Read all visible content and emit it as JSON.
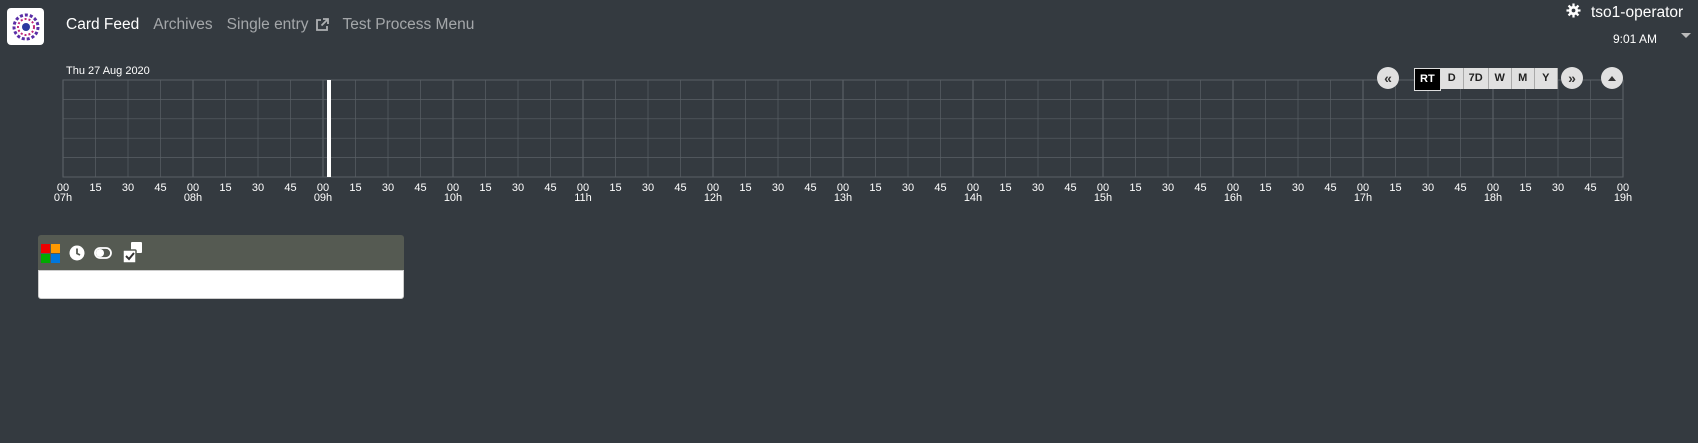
{
  "nav": {
    "items": [
      {
        "label": "Card Feed",
        "active": true
      },
      {
        "label": "Archives",
        "active": false
      },
      {
        "label": "Single entry",
        "active": false,
        "icon": "external-link-icon"
      },
      {
        "label": "Test Process Menu",
        "active": false
      }
    ]
  },
  "user": {
    "name": "tso1-operator",
    "icon": "gear-icon",
    "time": "9:01 AM"
  },
  "timeline": {
    "date": "Thu 27 Aug 2020",
    "zoom_buttons": [
      "RT",
      "D",
      "7D",
      "W",
      "M",
      "Y"
    ],
    "selected_zoom": "RT",
    "nav_prev_label": "«",
    "nav_next_label": "»",
    "minute_ticks": [
      "00",
      "15",
      "30",
      "45"
    ],
    "hours": [
      "07h",
      "08h",
      "09h",
      "10h",
      "11h",
      "12h",
      "13h",
      "14h",
      "15h",
      "16h",
      "17h",
      "18h",
      "19h"
    ],
    "current_time_hour": 9.0
  },
  "feed": {
    "tools": [
      "severity-filter-icon",
      "clock-icon",
      "toggle-icon",
      "acknowledge-icon"
    ]
  },
  "colors": {
    "background": "#343a40",
    "grid": "#5a6066",
    "feed_header": "#555a52"
  }
}
